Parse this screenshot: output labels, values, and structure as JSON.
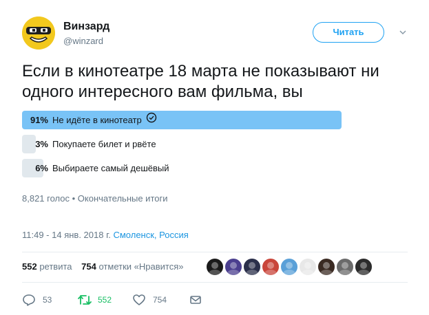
{
  "author": {
    "name": "Винзард",
    "handle": "@winzard"
  },
  "follow_label": "Читать",
  "tweet_text": "Если в кинотеатре 18 марта не показывают ни одного интересного вам фильма, вы",
  "poll": {
    "options": [
      {
        "percent": "91%",
        "value": 91,
        "label": "Не идёте в кинотеатр",
        "winner": true
      },
      {
        "percent": "3%",
        "value": 3,
        "label": "Покупаете билет и рвёте",
        "winner": false
      },
      {
        "percent": "6%",
        "value": 6,
        "label": "Выбираете самый дешёвый",
        "winner": false
      }
    ],
    "meta": "8,821 голос • Окончательные итоги"
  },
  "timestamp": {
    "time": "11:49 - 14 янв. 2018 г.",
    "location": "Смоленск, Россия"
  },
  "stats": {
    "retweets_count": "552",
    "retweets_label": "ретвита",
    "likes_count": "754",
    "likes_label": "отметки «Нравится»"
  },
  "liker_avatars": [
    "#1a1a1a",
    "#4b3f8f",
    "#2a2f4a",
    "#c9453a",
    "#5aa0d8",
    "#e8e8e8",
    "#3a2a22",
    "#6b6b6b",
    "#2b2b2b"
  ],
  "actions": {
    "reply_count": "53",
    "retweet_count": "552",
    "like_count": "754"
  },
  "colors": {
    "accent": "#1da1f2",
    "winner_bar": "#79c3f6",
    "bar": "#e1e8ed",
    "retweet": "#17bf63"
  }
}
